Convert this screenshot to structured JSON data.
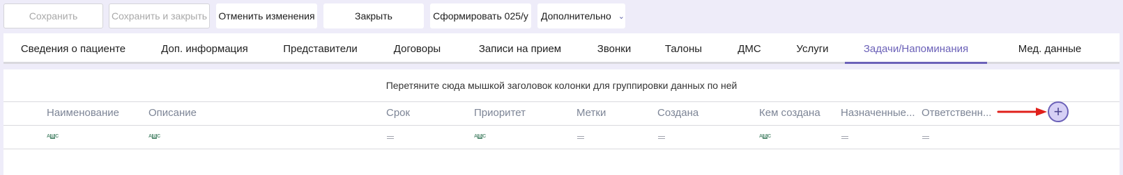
{
  "toolbar": {
    "save": "Сохранить",
    "save_close": "Сохранить и закрыть",
    "cancel_changes": "Отменить изменения",
    "close": "Закрыть",
    "form_025": "Сформировать 025/у",
    "more": "Дополнительно"
  },
  "tabs": [
    "Сведения о пациенте",
    "Доп. информация",
    "Представители",
    "Договоры",
    "Записи на прием",
    "Звонки",
    "Талоны",
    "ДМС",
    "Услуги",
    "Задачи/Напоминания",
    "Мед. данные"
  ],
  "active_tab": "Задачи/Напоминания",
  "grid": {
    "group_hint": "Перетяните сюда мышкой заголовок колонки для группировки данных по ней",
    "columns": [
      "Наименование",
      "Описание",
      "Срок",
      "Приоритет",
      "Метки",
      "Создана",
      "Кем создана",
      "Назначенные...",
      "Ответственн..."
    ],
    "filter_icons": [
      "text-filter-icon",
      "text-filter-icon",
      "equals-filter-icon",
      "text-filter-icon",
      "equals-filter-icon",
      "equals-filter-icon",
      "text-filter-icon",
      "equals-filter-icon",
      "equals-filter-icon"
    ]
  },
  "add_button_symbol": "+",
  "colors": {
    "accent": "#6b61b8",
    "background": "#eeecf9",
    "arrow": "#e0201b"
  }
}
